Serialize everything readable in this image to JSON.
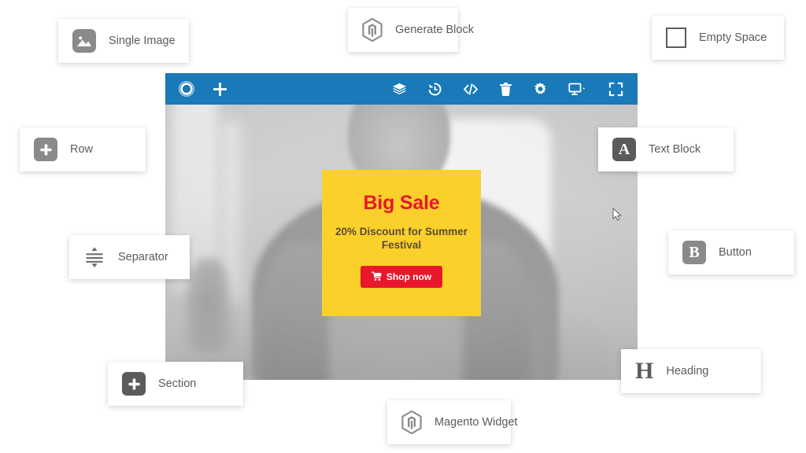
{
  "editor": {
    "toolbar": {
      "left_items": [
        {
          "name": "logo-icon",
          "label": "Page Builder logo"
        },
        {
          "name": "add-icon",
          "label": "Add"
        }
      ],
      "right_items": [
        {
          "name": "layers-icon",
          "label": "Layers"
        },
        {
          "name": "history-icon",
          "label": "History"
        },
        {
          "name": "code-icon",
          "label": "Code"
        },
        {
          "name": "trash-icon",
          "label": "Delete"
        },
        {
          "name": "gear-icon",
          "label": "Settings"
        },
        {
          "name": "monitor-icon",
          "label": "Viewport"
        },
        {
          "name": "fullscreen-icon",
          "label": "Fullscreen"
        }
      ],
      "background_color": "#1979b9"
    },
    "canvas": {
      "background_description": "grayscale photo of a woman in a tank top indoors"
    },
    "promo": {
      "title": "Big Sale",
      "subtitle": "20% Discount for Summer Festival",
      "button_label": "Shop now",
      "button_icon": "cart-icon",
      "background_color": "#fbd02b",
      "title_color": "#e8172b",
      "button_color": "#e8172b"
    }
  },
  "chips": [
    {
      "id": "single-image",
      "label": "Single Image",
      "icon": "image-icon"
    },
    {
      "id": "generate",
      "label": "Generate Block",
      "icon": "magento-icon"
    },
    {
      "id": "empty-space",
      "label": "Empty Space",
      "icon": "square-outline-icon"
    },
    {
      "id": "row",
      "label": "Row",
      "icon": "plus-tile-icon"
    },
    {
      "id": "text-block",
      "label": "Text Block",
      "icon": "letter-a-icon"
    },
    {
      "id": "separator",
      "label": "Separator",
      "icon": "separator-icon"
    },
    {
      "id": "button",
      "label": "Button",
      "icon": "letter-b-icon"
    },
    {
      "id": "section",
      "label": "Section",
      "icon": "plus-tile-icon"
    },
    {
      "id": "heading",
      "label": "Heading",
      "icon": "letter-h-icon"
    },
    {
      "id": "magento-widget",
      "label": "Magento Widget",
      "icon": "magento-icon"
    }
  ],
  "glyphs": {
    "letter_a": "A",
    "letter_b": "B",
    "letter_h": "H"
  }
}
